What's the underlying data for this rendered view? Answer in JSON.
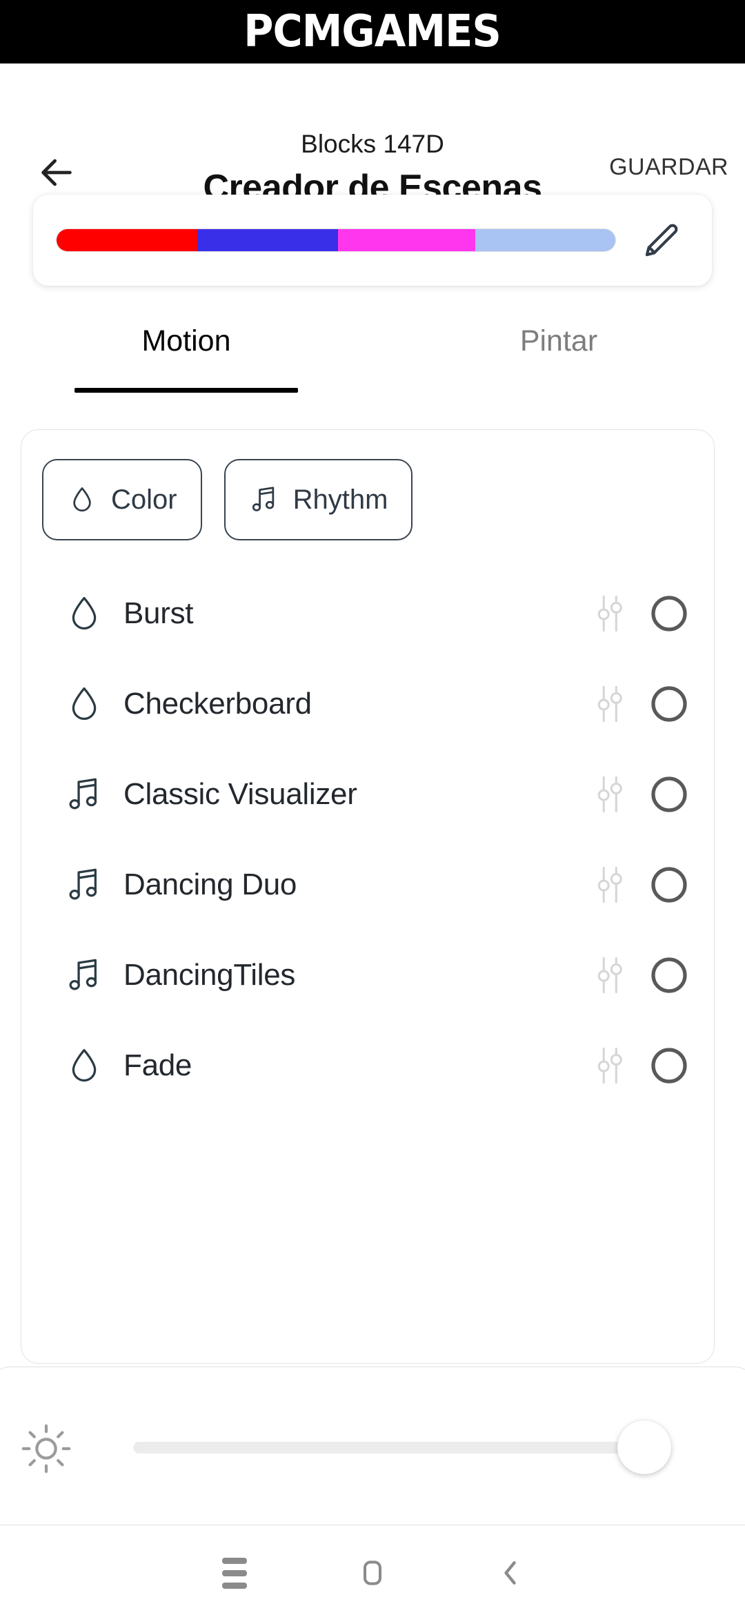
{
  "watermark": {
    "text": "PCMGAMES"
  },
  "appbar": {
    "back_icon": "arrow-left-icon",
    "subtitle": "Blocks 147D",
    "title": "Creador de Escenas",
    "save_label": "GUARDAR"
  },
  "palette": {
    "edit_icon": "pencil-icon",
    "colors": [
      {
        "hex": "#FF0000",
        "width_pct": 25.2
      },
      {
        "hex": "#3A2FE8",
        "width_pct": 25.2
      },
      {
        "hex": "#FF36EE",
        "width_pct": 24.6
      },
      {
        "hex": "#A9C3F2",
        "width_pct": 25.0
      }
    ]
  },
  "tabs": [
    {
      "label": "Motion",
      "active": true
    },
    {
      "label": "Pintar",
      "active": false
    }
  ],
  "filters": [
    {
      "label": "Color",
      "icon": "droplet-icon"
    },
    {
      "label": "Rhythm",
      "icon": "music-note-icon"
    }
  ],
  "effects": [
    {
      "label": "Burst",
      "icon": "droplet-icon",
      "sliders_icon": "sliders-icon",
      "selected": false
    },
    {
      "label": "Checkerboard",
      "icon": "droplet-icon",
      "sliders_icon": "sliders-icon",
      "selected": false
    },
    {
      "label": "Classic Visualizer",
      "icon": "music-note-icon",
      "sliders_icon": "sliders-icon",
      "selected": false
    },
    {
      "label": "Dancing Duo",
      "icon": "music-note-icon",
      "sliders_icon": "sliders-icon",
      "selected": false
    },
    {
      "label": "DancingTiles",
      "icon": "music-note-icon",
      "sliders_icon": "sliders-icon",
      "selected": false
    },
    {
      "label": "Fade",
      "icon": "droplet-icon",
      "sliders_icon": "sliders-icon",
      "selected": false
    }
  ],
  "brightness": {
    "icon": "brightness-sun-icon",
    "value_pct": 95
  },
  "navbar": {
    "recents_icon": "recents-icon",
    "home_icon": "home-icon",
    "back_icon": "back-chevron-icon"
  },
  "theme": {
    "accent_dark": "#2f3a45",
    "text_primary": "#1b1b1b",
    "text_muted": "#7d7d7d",
    "card_border": "#e3e3e3"
  }
}
